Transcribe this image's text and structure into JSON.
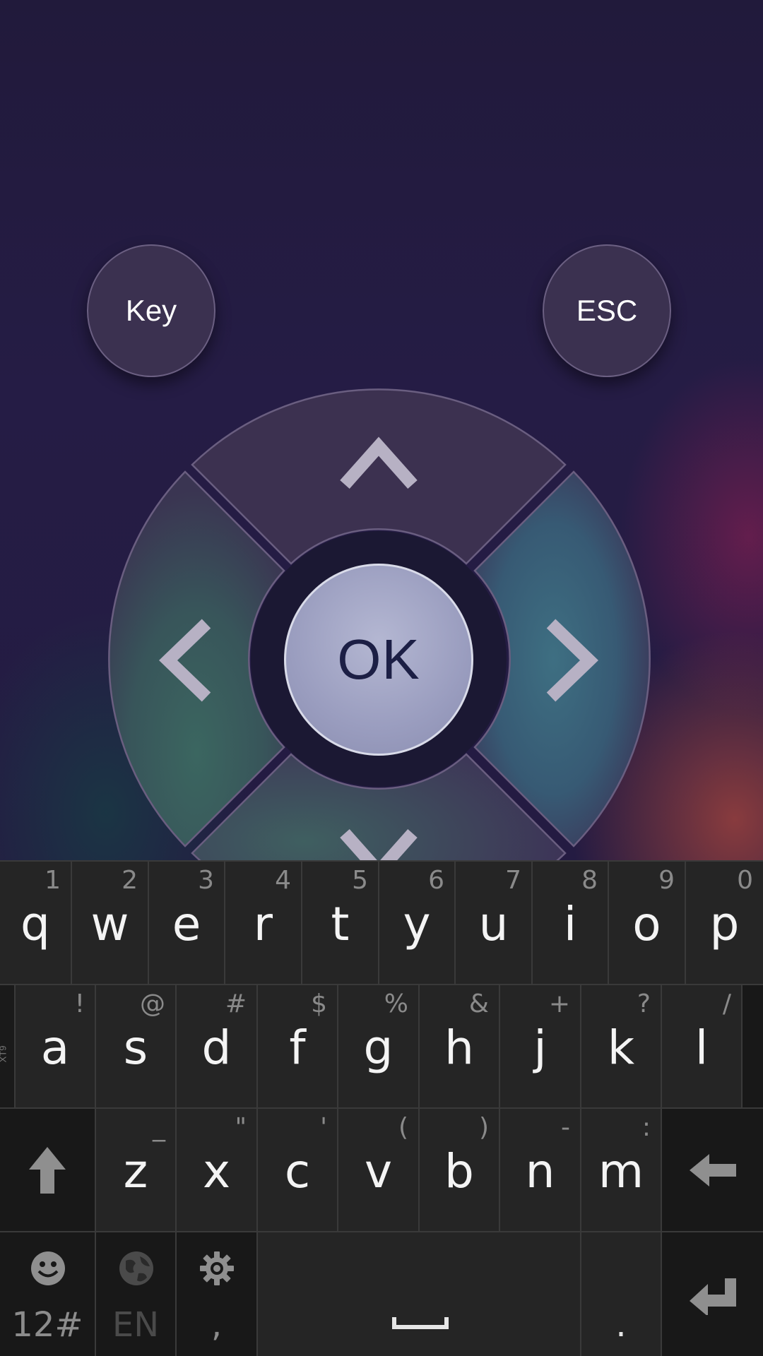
{
  "remote": {
    "key_label": "Key",
    "esc_label": "ESC",
    "ok_label": "OK"
  },
  "keyboard": {
    "row1": [
      {
        "main": "q",
        "sub": "1"
      },
      {
        "main": "w",
        "sub": "2"
      },
      {
        "main": "e",
        "sub": "3"
      },
      {
        "main": "r",
        "sub": "4"
      },
      {
        "main": "t",
        "sub": "5"
      },
      {
        "main": "y",
        "sub": "6"
      },
      {
        "main": "u",
        "sub": "7"
      },
      {
        "main": "i",
        "sub": "8"
      },
      {
        "main": "o",
        "sub": "9"
      },
      {
        "main": "p",
        "sub": "0"
      }
    ],
    "row2_side_label": "XT9",
    "row2": [
      {
        "main": "a",
        "sub": "!"
      },
      {
        "main": "s",
        "sub": "@"
      },
      {
        "main": "d",
        "sub": "#"
      },
      {
        "main": "f",
        "sub": "$"
      },
      {
        "main": "g",
        "sub": "%"
      },
      {
        "main": "h",
        "sub": "&"
      },
      {
        "main": "j",
        "sub": "+"
      },
      {
        "main": "k",
        "sub": "?"
      },
      {
        "main": "l",
        "sub": "/"
      }
    ],
    "row3": [
      {
        "main": "z",
        "sub": "_"
      },
      {
        "main": "x",
        "sub": "\""
      },
      {
        "main": "c",
        "sub": "'"
      },
      {
        "main": "v",
        "sub": "("
      },
      {
        "main": "b",
        "sub": ")"
      },
      {
        "main": "n",
        "sub": "-"
      },
      {
        "main": "m",
        "sub": ":"
      }
    ],
    "row4": {
      "symbols_label": "12#",
      "language_label": "EN",
      "comma_label": ",",
      "period_label": "."
    }
  }
}
